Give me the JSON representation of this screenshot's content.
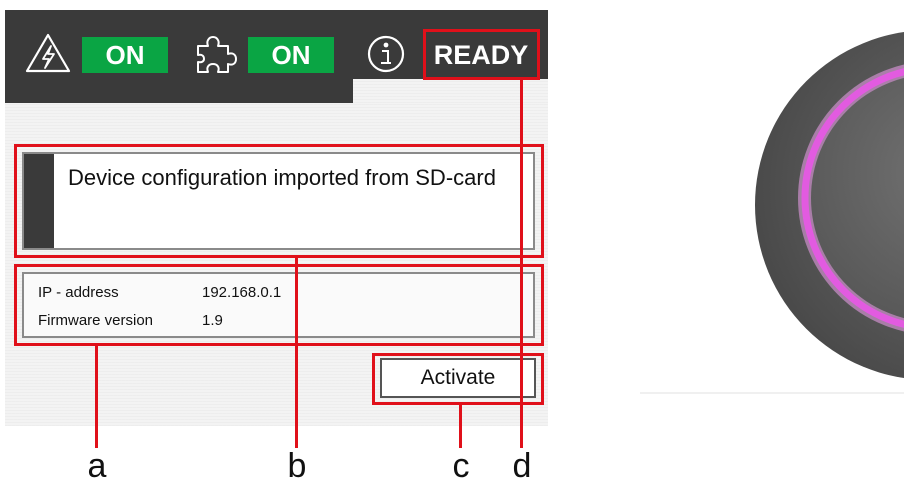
{
  "statusbar": {
    "power_icon": "lightning-triangle-icon",
    "power_state": "ON",
    "plugin_icon": "puzzle-piece-icon",
    "plugin_state": "ON",
    "info_icon": "info-circle-icon",
    "status": "READY"
  },
  "message": {
    "text": "Device configuration imported from SD-card"
  },
  "info": {
    "rows": [
      {
        "label": "IP - address",
        "value": "192.168.0.1"
      },
      {
        "label": "Firmware version",
        "value": "1.9"
      }
    ]
  },
  "actions": {
    "activate_label": "Activate"
  },
  "callouts": {
    "a": "a",
    "b": "b",
    "c": "c",
    "d": "d"
  },
  "colors": {
    "topbar": "#3a3a3a",
    "on_badge": "#0aa544",
    "annotation_red": "#e0101a",
    "knob_ring": "#e25be0",
    "knob_body": "#5a5a5a"
  }
}
